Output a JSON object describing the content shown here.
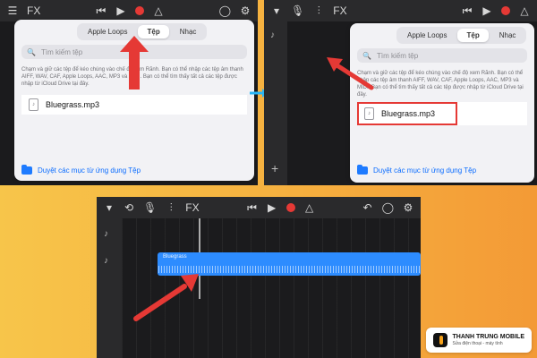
{
  "toolbar": {
    "fx_label": "FX"
  },
  "browser": {
    "tabs": [
      {
        "label": "Apple Loops"
      },
      {
        "label": "Tệp"
      },
      {
        "label": "Nhạc"
      }
    ],
    "search_placeholder": "Tìm kiếm tệp",
    "panel1_description": "Chạm và giữ các tệp để kéo chúng vào chế độ xem Rãnh. Bạn có thể nhập các tệp âm thanh AIFF, WAV, CAF, Apple Loops, AAC, MP3 và MIDI. Bạn có thể tìm thấy tất cả các tệp được nhập từ iCloud Drive tại đây.",
    "panel2_description": "Chạm và giữ các tệp để kéo chúng vào chế độ xem Rãnh. Bạn có thể nhập các tệp âm thanh AIFF, WAV, CAF, Apple Loops, AAC, MP3 và MIDI. Bạn có thể tìm thấy tất cả các tệp được nhập từ iCloud Drive tại đây.",
    "file_name": "Bluegrass.mp3",
    "browse_link": "Duyệt các mục từ ứng dụng Tệp"
  },
  "track": {
    "region_label": "Bluegrass"
  },
  "brand": {
    "name": "THANH TRUNG MOBILE",
    "tagline": "Sửa điện thoại - máy tính"
  },
  "colors": {
    "background_left": "#f7c54a",
    "background_right": "#f39a36",
    "accent_red": "#e53935",
    "accent_blue": "#2d8cff",
    "link_blue": "#0a6cff"
  },
  "icons": {
    "back": "back-icon",
    "record": "record-icon",
    "play": "play-icon",
    "mic": "mic-icon",
    "loop": "loop-icon",
    "mixer": "mixer-icon",
    "settings": "gear-icon"
  }
}
